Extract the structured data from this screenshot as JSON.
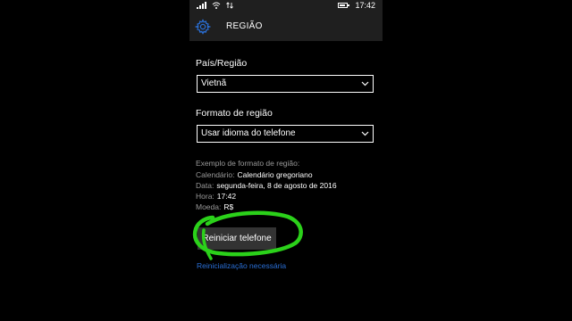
{
  "status_bar": {
    "time": "17:42"
  },
  "header": {
    "title": "REGIÃO"
  },
  "country": {
    "label": "País/Região",
    "value": "Vietnã"
  },
  "format": {
    "label": "Formato de região",
    "value": "Usar idioma do telefone"
  },
  "example": {
    "heading": "Exemplo de formato de região:",
    "rows": [
      {
        "key": "Calendário:",
        "value": "Calendário gregoriano"
      },
      {
        "key": "Data:",
        "value": "segunda-feira, 8 de agosto de 2016"
      },
      {
        "key": "Hora:",
        "value": "17:42"
      },
      {
        "key": "Moeda:",
        "value": "R$"
      }
    ]
  },
  "restart_button": {
    "label": "Reiniciar telefone"
  },
  "restart_note": "Reinicialização necessária",
  "colors": {
    "accent": "#2a6fd6",
    "highlight": "#2bd11a"
  }
}
